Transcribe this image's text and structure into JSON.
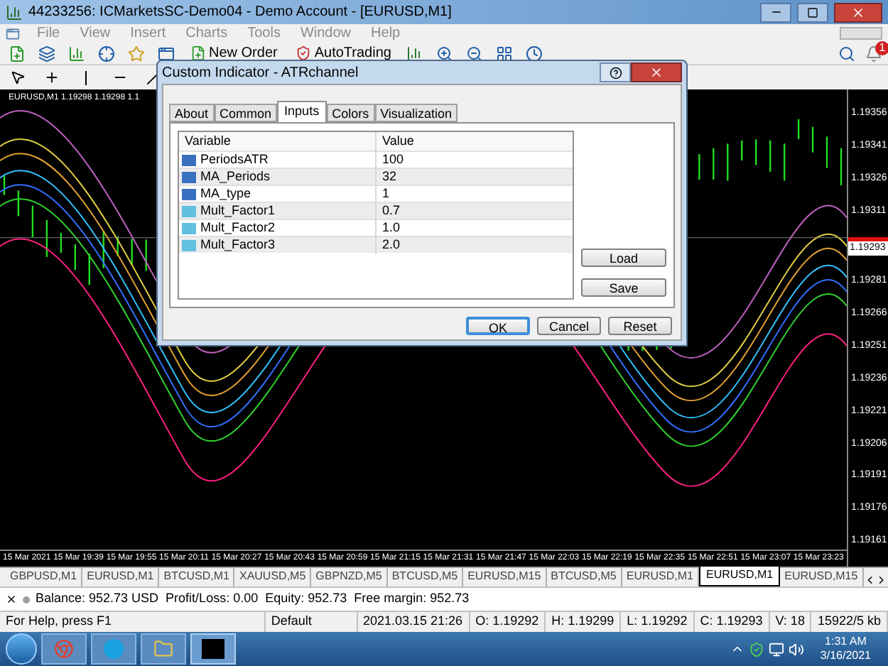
{
  "window": {
    "title": "44233256: ICMarketsSC-Demo04 - Demo Account - [EURUSD,M1]"
  },
  "menu": [
    "File",
    "View",
    "Insert",
    "Charts",
    "Tools",
    "Window",
    "Help"
  ],
  "toolbar": {
    "new_order": "New Order",
    "autotrading": "AutoTrading",
    "alert_count": "1"
  },
  "chart": {
    "header": "EURUSD,M1  1.19298 1.19298 1.1",
    "price_labels": [
      "1.19356",
      "1.19341",
      "1.19326",
      "1.19311",
      "1.19281",
      "1.19266",
      "1.19251",
      "1.19236",
      "1.19221",
      "1.19206",
      "1.19191",
      "1.19176",
      "1.19161"
    ],
    "bid_label": "1.19293",
    "time_labels": [
      "15 Mar 2021",
      "15 Mar 19:39",
      "15 Mar 19:55",
      "15 Mar 20:11",
      "15 Mar 20:27",
      "15 Mar 20:43",
      "15 Mar 20:59",
      "15 Mar 21:15",
      "15 Mar 21:31",
      "15 Mar 21:47",
      "15 Mar 22:03",
      "15 Mar 22:19",
      "15 Mar 22:35",
      "15 Mar 22:51",
      "15 Mar 23:07",
      "15 Mar 23:23"
    ]
  },
  "dialog": {
    "title": "Custom Indicator - ATRchannel",
    "tabs": [
      {
        "label": "About",
        "selected": false
      },
      {
        "label": "Common",
        "selected": false
      },
      {
        "label": "Inputs",
        "selected": true
      },
      {
        "label": "Colors",
        "selected": false
      },
      {
        "label": "Visualization",
        "selected": false
      }
    ],
    "columns": [
      "Variable",
      "Value"
    ],
    "rows": [
      {
        "variable": "PeriodsATR",
        "value": "100",
        "kind": "int"
      },
      {
        "variable": "MA_Periods",
        "value": "32",
        "kind": "int"
      },
      {
        "variable": "MA_type",
        "value": "1",
        "kind": "int"
      },
      {
        "variable": "Mult_Factor1",
        "value": "0.7",
        "kind": "double"
      },
      {
        "variable": "Mult_Factor2",
        "value": "1.0",
        "kind": "double"
      },
      {
        "variable": "Mult_Factor3",
        "value": "2.0",
        "kind": "double"
      }
    ],
    "side_buttons": [
      "Load",
      "Save"
    ],
    "buttons": [
      {
        "label": "OK",
        "selected": true
      },
      {
        "label": "Cancel",
        "selected": false
      },
      {
        "label": "Reset",
        "selected": false
      }
    ]
  },
  "symbol_tabs": [
    {
      "label": "GBPUSD,M1",
      "selected": false
    },
    {
      "label": "EURUSD,M1",
      "selected": false
    },
    {
      "label": "BTCUSD,M1",
      "selected": false
    },
    {
      "label": "XAUUSD,M5",
      "selected": false
    },
    {
      "label": "GBPNZD,M5",
      "selected": false
    },
    {
      "label": "BTCUSD,M5",
      "selected": false
    },
    {
      "label": "EURUSD,M15",
      "selected": false
    },
    {
      "label": "BTCUSD,M5",
      "selected": false
    },
    {
      "label": "EURUSD,M1",
      "selected": false
    },
    {
      "label": "EURUSD,M1",
      "selected": true
    },
    {
      "label": "EURUSD,M15",
      "selected": false
    }
  ],
  "terminal": {
    "balance": "Balance: 952.73 USD  Profit/Loss: 0.00  Equity: 952.73  Free margin: 952.73"
  },
  "status_bar": [
    "For Help, press F1",
    "Default",
    "2021.03.15 21:26",
    "O: 1.19292",
    "H: 1.19299",
    "L: 1.19292",
    "C: 1.19293",
    "V: 18",
    "15922/5 kb"
  ],
  "taskbar": {
    "time": "1:31 AM",
    "date": "3/16/2021"
  }
}
